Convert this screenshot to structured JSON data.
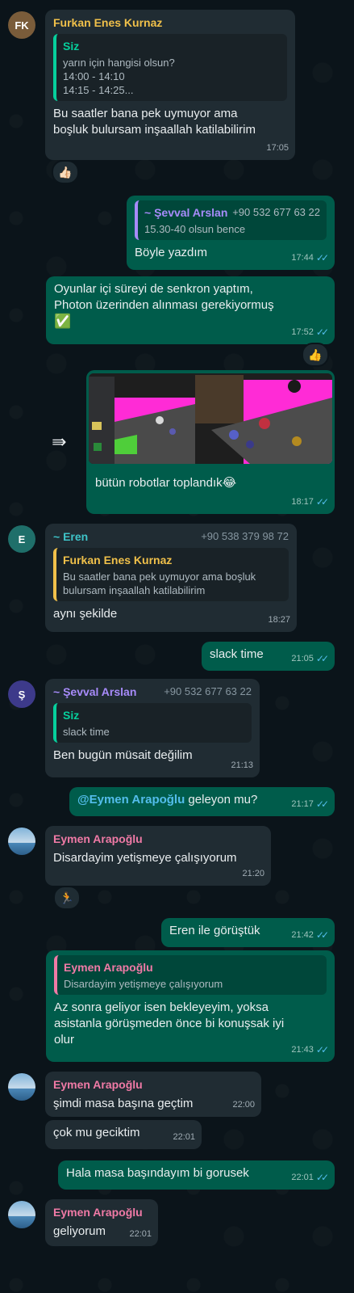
{
  "messages": {
    "m1": {
      "avatar_initials": "FK",
      "sender": "Furkan Enes Kurnaz",
      "quote_name": "Siz",
      "quote_lines": [
        "yarın için hangisi olsun?",
        "14:00 - 14:10",
        "14:15 - 14:25..."
      ],
      "text_1": "Bu saatler bana pek uymuyor ama",
      "text_2": "boşluk bulursam inşaallah katilabilirim",
      "time": "17:05",
      "reaction": "👍🏻"
    },
    "m2": {
      "quote_name": "~ Şevval Arslan",
      "quote_phone": "+90 532 677 63 22",
      "quote_line": "15.30-40 olsun bence",
      "text": "Böyle yazdım",
      "time": "17:44"
    },
    "m3": {
      "text_1": "Oyunlar içi süreyi de senkron yaptım,",
      "text_2": "Photon üzerinden alınması gerekiyormuş",
      "emoji": "✅",
      "time": "17:52",
      "reaction": "👍"
    },
    "m4": {
      "caption": "bütün robotlar toplandık😂",
      "time": "18:17",
      "forward_icon": "share-arrow-icon"
    },
    "m5": {
      "avatar_initials": "E",
      "sender": "~ Eren",
      "phone": "+90 538 379 98 72",
      "quote_name": "Furkan Enes Kurnaz",
      "quote_line_1": "Bu saatler bana pek uymuyor ama boşluk",
      "quote_line_2": "bulursam inşaallah katilabilirim",
      "text": "aynı şekilde",
      "time": "18:27"
    },
    "m6": {
      "text": "slack time",
      "time": "21:05"
    },
    "m7": {
      "avatar_initials": "Ş",
      "sender": "~ Şevval Arslan",
      "phone": "+90 532 677 63 22",
      "quote_name": "Siz",
      "quote_line": "slack time",
      "text": "Ben bugün müsait değilim",
      "time": "21:13"
    },
    "m8": {
      "mention": "@Eymen Arapoğlu",
      "text": " geleyon mu?",
      "time": "21:17"
    },
    "m9": {
      "sender": "Eymen Arapoğlu",
      "text": "Disardayim yetişmeye çalışıyorum",
      "time": "21:20",
      "reaction": "🏃"
    },
    "m10": {
      "text": "Eren ile görüştük",
      "time": "21:42"
    },
    "m11": {
      "quote_name": "Eymen Arapoğlu",
      "quote_line": "Disardayim yetişmeye çalışıyorum",
      "text_1": "Az sonra geliyor isen bekleyeyim, yoksa",
      "text_2": "asistanla görüşmeden önce bi konuşsak iyi",
      "text_3": "olur",
      "time": "21:43"
    },
    "m12": {
      "sender": "Eymen Arapoğlu",
      "text": "şimdi masa başına geçtim",
      "time": "22:00"
    },
    "m13": {
      "text": "çok mu geciktim",
      "time": "22:01"
    },
    "m14": {
      "text": "Hala masa başındayım bi gorusek",
      "time": "22:01"
    },
    "m15": {
      "sender": "Eymen Arapoğlu",
      "text": "geliyorum",
      "time": "22:01"
    }
  },
  "colors": {
    "background": "#0b141a",
    "incoming": "#202c33",
    "outgoing": "#005c4b",
    "name_furkan": "#f0c04a",
    "name_eren": "#3ec4c9",
    "name_sevval": "#a78bfa",
    "name_eymen": "#f07aa6",
    "read_ticks": "#53bdeb"
  }
}
